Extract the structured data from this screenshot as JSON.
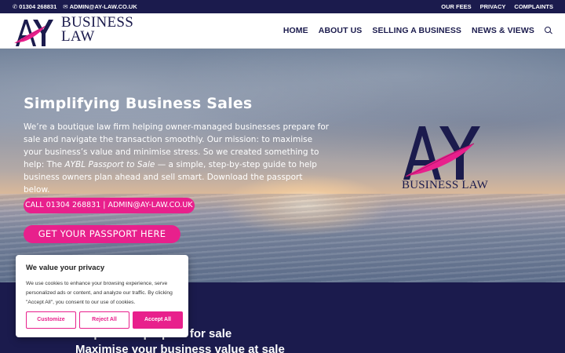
{
  "topbar": {
    "phone": "01304 268831",
    "email": "ADMIN@AY-LAW.CO.UK",
    "links": [
      "OUR FEES",
      "PRIVACY",
      "COMPLAINTS"
    ]
  },
  "header": {
    "logo_letters": "AY",
    "logo_line1": "BUSINESS",
    "logo_line2": "LAW",
    "nav": [
      "HOME",
      "ABOUT US",
      "SELLING A BUSINESS",
      "NEWS & VIEWS"
    ]
  },
  "hero": {
    "title": "Simplifying Business Sales",
    "intro_part1": "We’re a boutique law firm helping owner-managed businesses prepare for sale and navigate the transaction smoothly. Our mission: to maximise your business’s value and minimise stress. So we created something to help: The ",
    "intro_em": "AYBL Passport to Sale",
    "intro_part2": " — a simple, step-by-step guide to help business owners plan ahead and sell smart. Download the passport below.",
    "call_button": "CALL 01304 268831 | ADMIN@AY-LAW.CO.UK",
    "passport_button": "GET YOUR PASSPORT HERE",
    "logo_letters": "AY",
    "logo_text": "BUSINESS LAW"
  },
  "lower": {
    "line1": "Help others prepare for sale",
    "line2": "Maximise your business value at sale"
  },
  "cookie": {
    "title": "We value your privacy",
    "text": "We use cookies to enhance your browsing experience, serve personalized ads or content, and analyze our traffic. By clicking \"Accept All\", you consent to our use of cookies.",
    "customize": "Customize",
    "reject": "Reject All",
    "accept": "Accept All"
  },
  "colors": {
    "navy": "#1b1b4d",
    "pink": "#e8208c"
  }
}
